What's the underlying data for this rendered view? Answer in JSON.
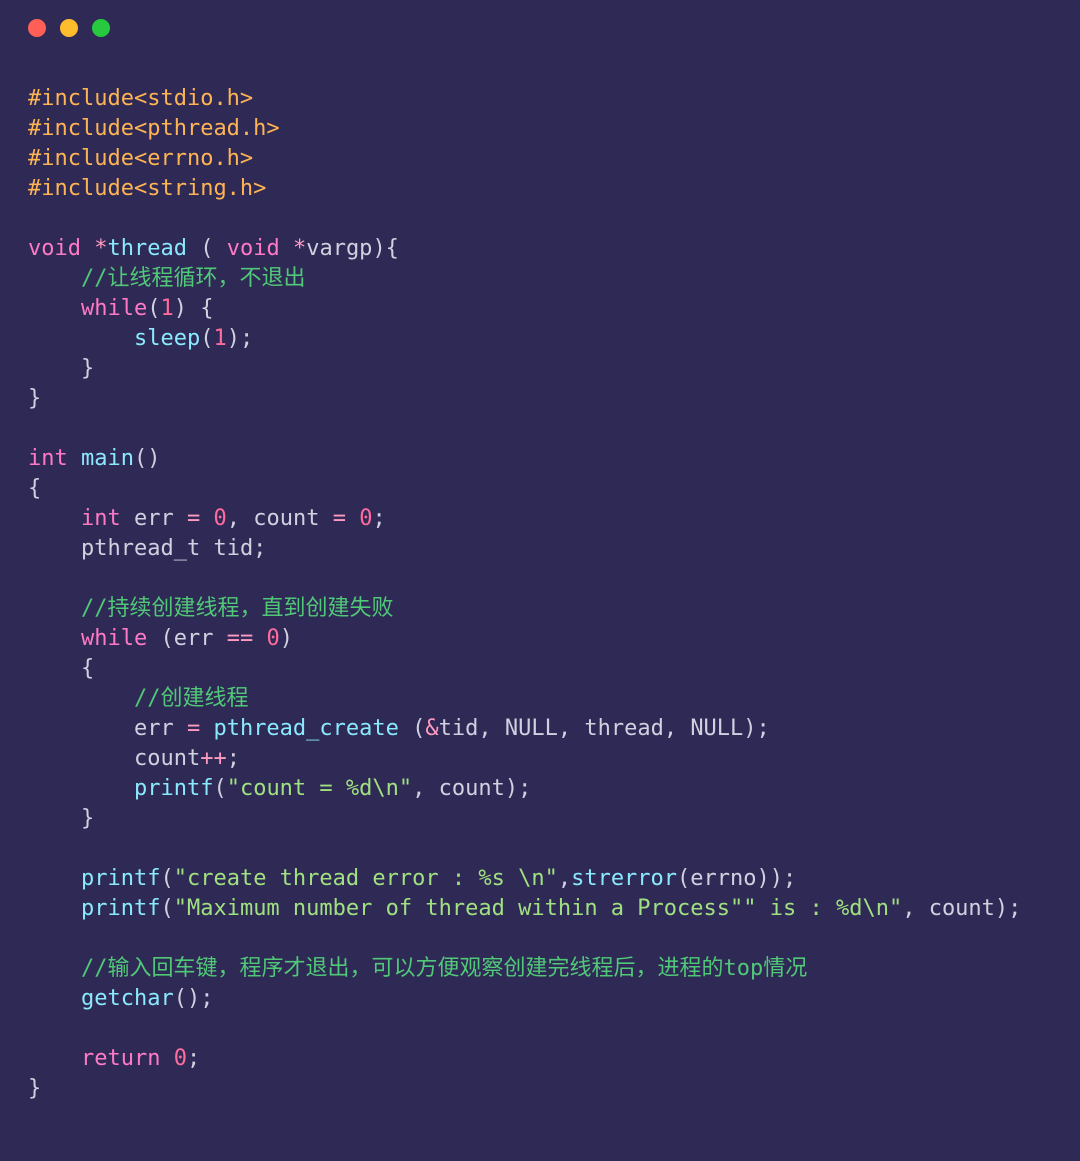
{
  "window": {
    "dots": [
      "red",
      "yellow",
      "green"
    ]
  },
  "code": {
    "include1": "#include",
    "include1_h": "<stdio.h>",
    "include2": "#include",
    "include2_h": "<pthread.h>",
    "include3": "#include",
    "include3_h": "<errno.h>",
    "include4": "#include",
    "include4_h": "<string.h>",
    "kw_void": "void",
    "star1": "*",
    "fn_thread": "thread",
    "space_paren_open": " ( ",
    "kw_void2": "void",
    "star2": " *",
    "id_vargp": "vargp",
    "paren_close_brace": "){",
    "cmt_thread_loop": "//让线程循环，不退出",
    "kw_while1": "while",
    "paren_open1": "(",
    "num_1a": "1",
    "paren_close1": ") {",
    "fn_sleep": "sleep",
    "paren_open2": "(",
    "num_1b": "1",
    "paren_close2": ");",
    "brace_close1": "}",
    "brace_close2": "}",
    "kw_int": "int",
    "fn_main": "main",
    "main_parens": "()",
    "brace_open2": "{",
    "kw_int2": "int",
    "id_err": " err ",
    "op_eq1": "= ",
    "num_0a": "0",
    "comma1": ", count ",
    "op_eq2": "= ",
    "num_0b": "0",
    "semi1": ";",
    "id_pthread_t": "pthread_t",
    "id_tid": " tid;",
    "cmt_keep_create": "//持续创建线程，直到创建失败",
    "kw_while2": "while",
    "while2_open": " (err ",
    "op_eqeq": "== ",
    "num_0c": "0",
    "while2_close": ")",
    "brace_open3": "{",
    "cmt_create": "//创建线程",
    "assign_err": "err ",
    "op_eq3": "= ",
    "fn_pthread_create": "pthread_create",
    "pc_args_open": " (",
    "amp": "&",
    "pc_args_rest": "tid, ",
    "null1": "NULL",
    "pc_comma1": ", thread, ",
    "null2": "NULL",
    "pc_close": ");",
    "count_inc": "count",
    "op_pp": "++",
    "semi_pp": ";",
    "fn_printf1": "printf",
    "p1_open": "(",
    "str_count": "\"count = %d\\n\"",
    "p1_rest": ", count);",
    "brace_close3": "}",
    "fn_printf2": "printf",
    "p2_open": "(",
    "str_err": "\"create thread error : %s \\n\"",
    "p2_rest": ",",
    "fn_strerror": "strerror",
    "p2_paren": "(errno));",
    "fn_printf3": "printf",
    "p3_open": "(",
    "str_max": "\"Maximum number of thread within a Process\"\" is : %d\\n\"",
    "p3_rest": ", count);",
    "cmt_getchar": "//输入回车键，程序才退出，可以方便观察创建完线程后，进程的top情况",
    "fn_getchar": "getchar",
    "getchar_call": "();",
    "kw_return": "return",
    "sp_ret": " ",
    "num_0d": "0",
    "semi_ret": ";",
    "brace_close4": "}"
  }
}
